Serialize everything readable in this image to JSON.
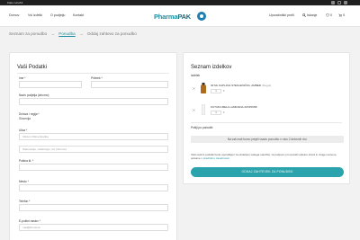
{
  "topbar": {
    "text": "Kako naročiti"
  },
  "nav": {
    "items": [
      "Domov",
      "Vsi izdelki",
      "O podjetju",
      "Kontakt"
    ]
  },
  "brand": {
    "name_part1": "Pharma",
    "name_part2": "PAK"
  },
  "header": {
    "profile_label": "Uporabniški profil",
    "search_label": "Iskanje",
    "wishlist_count": "0",
    "cart_count": "0"
  },
  "breadcrumb": {
    "items": [
      "Seznam za ponudbo",
      "Ponudba",
      "Oddaj zahtevo za ponudbo"
    ],
    "separator": "→"
  },
  "form": {
    "title": "Vaši Podatki",
    "name_label": "Ime *",
    "surname_label": "Priimek *",
    "company_label": "Naziv podjetja (izborno)",
    "country_label": "Država / regija *",
    "country_value": "Slovenija",
    "street_label": "Ulica *",
    "street_placeholder": "Ulica in hišna številka",
    "street2_placeholder": "Stanovanje, nadstropje, itd. (izborno)",
    "postal_label": "Poštna št. *",
    "city_label": "Mesto *",
    "phone_label": "Telefon *",
    "email_label": "E-poštni naslov *",
    "email_placeholder": "mail@domena"
  },
  "order": {
    "title": "Seznam izdelkov",
    "col_label": "Izdelek",
    "items": [
      {
        "name": "30 ML KAPLJNA STEKLENIČKA, AMBER",
        "note": "(Regija)",
        "qty": "1"
      },
      {
        "name": "KUTIJKA BELA LAMINANA 22X35X88",
        "note": "",
        "qty": "1"
      }
    ],
    "remark_label": "Pošlji po ponudbi",
    "notice": "Na vaš mail bomo prejeli vsado ponudbo v roku 2 delovnih dni.",
    "privacy_text": "Vaši osebni podatki bodo uporabljeni za obdelavo vašega naročila, za podporo pri uporabi spletne strani in druge namene, opisane v ",
    "privacy_link": "pravilnik o zasebnosti",
    "submit_label": "ODDAJ ZAHTEVEK ZA PONUDBO"
  },
  "colors": {
    "accent": "#2aa3ad",
    "brand": "#1e8fa0",
    "dark": "#1f1f1f"
  },
  "icons": [
    "search-icon",
    "heart-icon",
    "cart-icon",
    "facebook-icon",
    "instagram-icon",
    "close-icon"
  ]
}
